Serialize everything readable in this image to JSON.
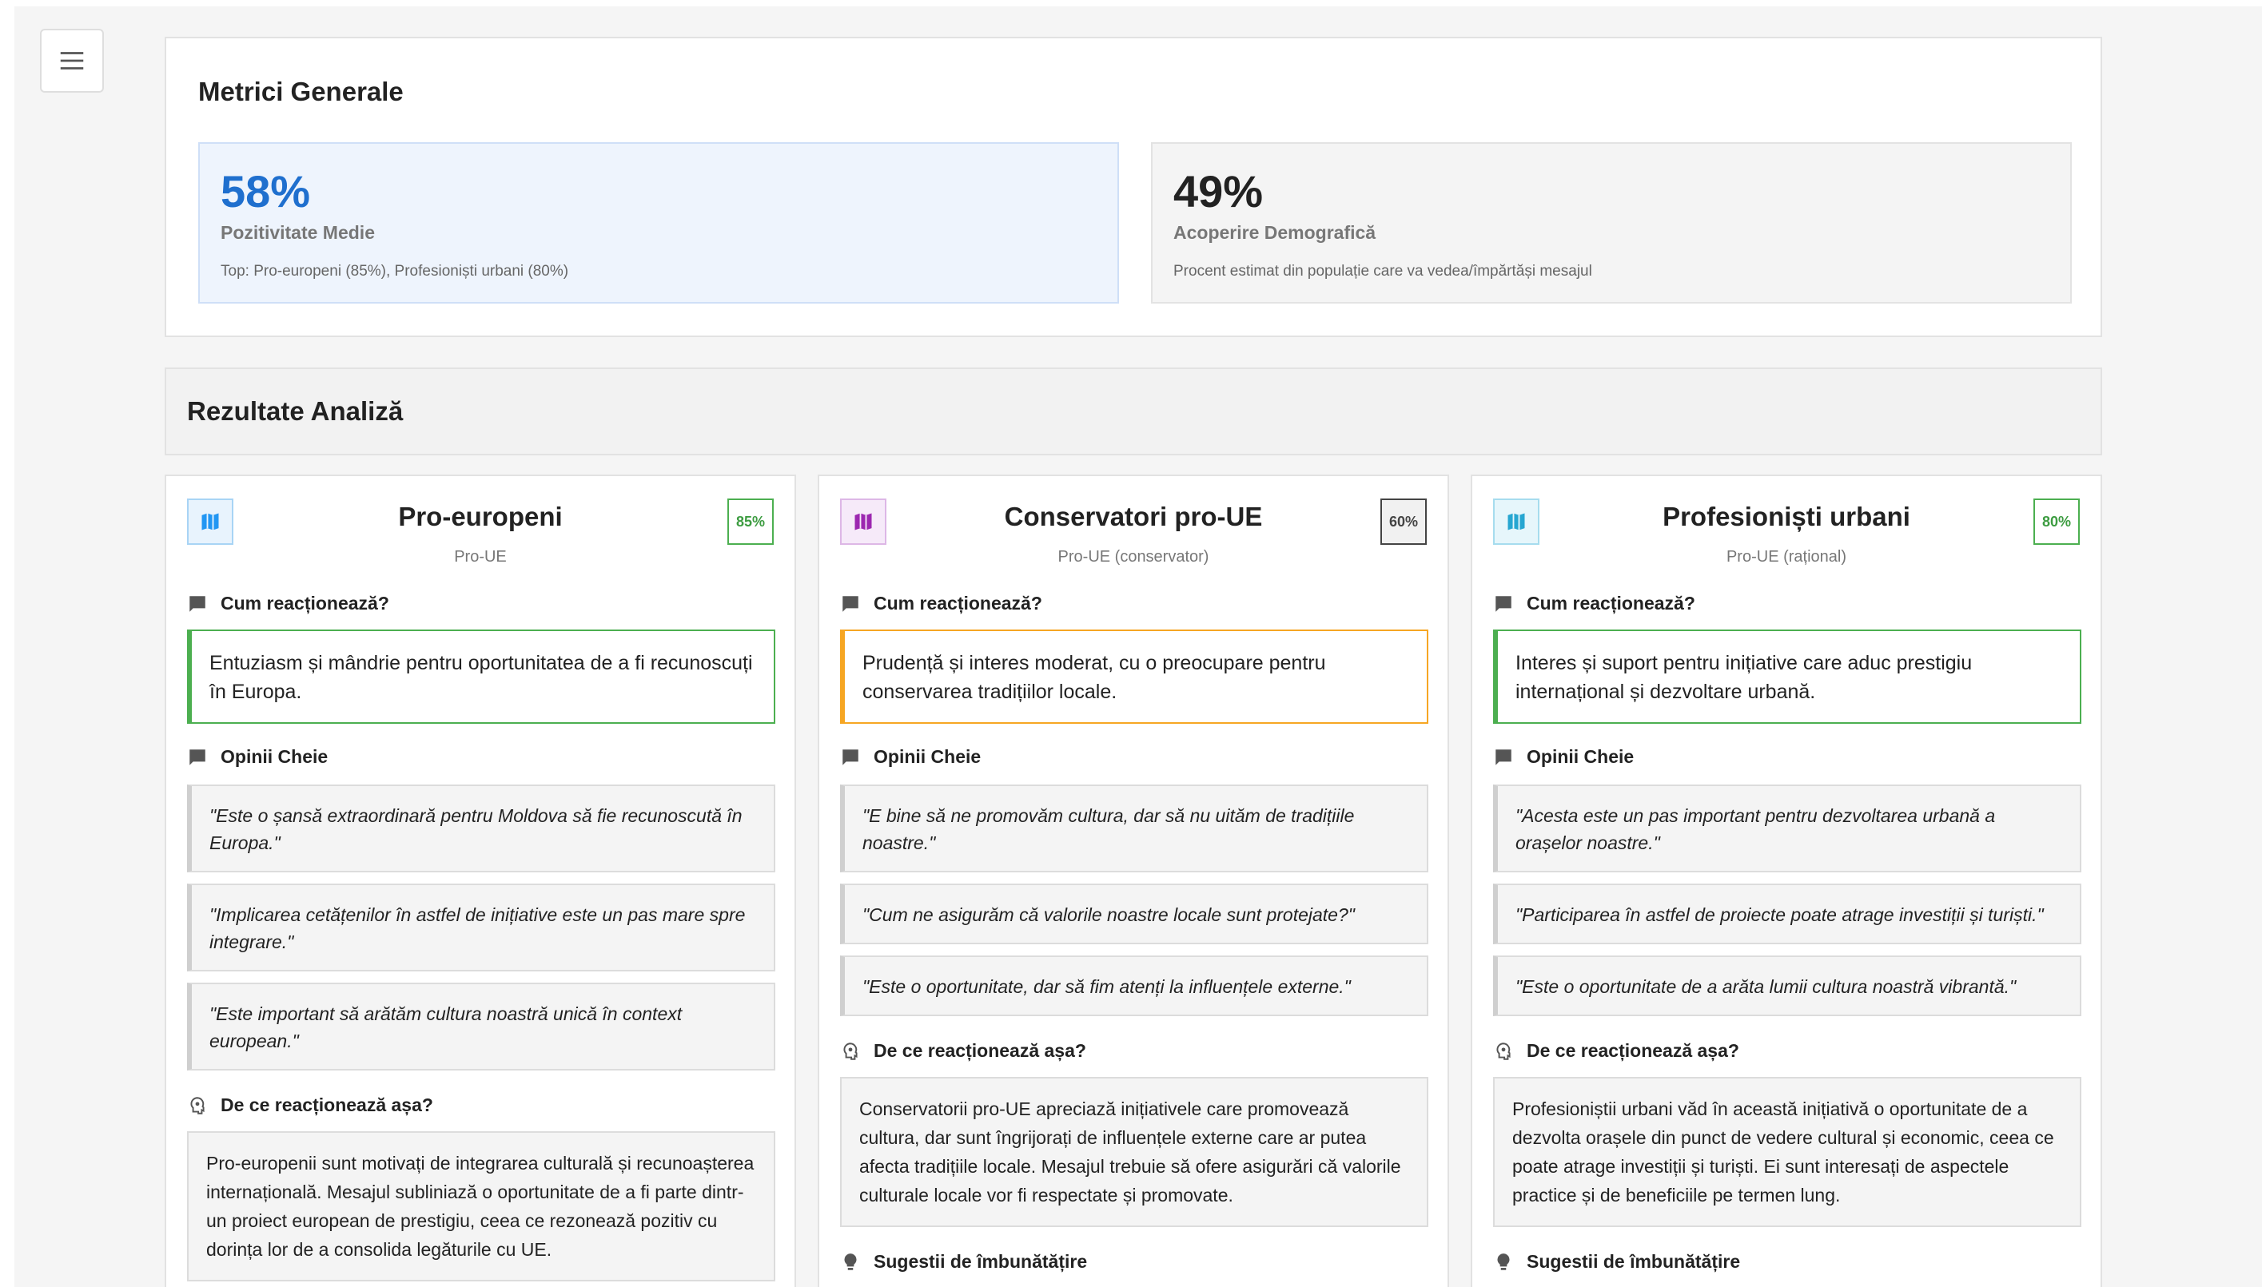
{
  "menu": {
    "icon": "menu-icon"
  },
  "metrics": {
    "title": "Metrici Generale",
    "items": [
      {
        "value": "58%",
        "label": "Pozitivitate Medie",
        "note": "Top: Pro-europeni (85%), Profesioniști urbani (80%)",
        "color": "#1f6fce"
      },
      {
        "value": "49%",
        "label": "Acoperire Demografică",
        "note": "Procent estimat din populație care va vedea/împărtăși mesajul",
        "color": "#222222"
      }
    ]
  },
  "results": {
    "title": "Rezultate Analiză",
    "cards": [
      {
        "icon": "map-icon",
        "icon_color": "#2196f3",
        "title": "Pro-europeni",
        "subtitle": "Pro-UE",
        "score": "85%",
        "react_heading": "Cum reacționează?",
        "reaction": "Entuziasm și mândrie pentru oportunitatea de a fi recunoscuți în Europa.",
        "opinions_heading": "Opinii Cheie",
        "quotes": [
          "\"Este o șansă extraordinară pentru Moldova să fie recunoscută în Europa.\"",
          "\"Implicarea cetățenilor în astfel de inițiative este un pas mare spre integrare.\"",
          "\"Este important să arătăm cultura noastră unică în context european.\""
        ],
        "why_heading": "De ce reacționează așa?",
        "reason": "Pro-europenii sunt motivați de integrarea culturală și recunoașterea internațională. Mesajul subliniază o oportunitate de a fi parte dintr-un proiect european de prestigiu, ceea ce rezonează pozitiv cu dorința lor de a consolida legăturile cu UE."
      },
      {
        "icon": "map-icon",
        "icon_color": "#9c27b0",
        "title": "Conservatori pro-UE",
        "subtitle": "Pro-UE (conservator)",
        "score": "60%",
        "react_heading": "Cum reacționează?",
        "reaction": "Prudență și interes moderat, cu o preocupare pentru conservarea tradițiilor locale.",
        "opinions_heading": "Opinii Cheie",
        "quotes": [
          "\"E bine să ne promovăm cultura, dar să nu uităm de tradițiile noastre.\"",
          "\"Cum ne asigurăm că valorile noastre locale sunt protejate?\"",
          "\"Este o oportunitate, dar să fim atenți la influențele externe.\""
        ],
        "why_heading": "De ce reacționează așa?",
        "reason": "Conservatorii pro-UE apreciază inițiativele care promovează cultura, dar sunt îngrijorați de influențele externe care ar putea afecta tradițiile locale. Mesajul trebuie să ofere asigurări că valorile culturale locale vor fi respectate și promovate.",
        "suggest_heading": "Sugestii de îmbunătățire"
      },
      {
        "icon": "map-icon",
        "icon_color": "#26a6d1",
        "title": "Profesioniști urbani",
        "subtitle": "Pro-UE (rațional)",
        "score": "80%",
        "react_heading": "Cum reacționează?",
        "reaction": "Interes și suport pentru inițiative care aduc prestigiu internațional și dezvoltare urbană.",
        "opinions_heading": "Opinii Cheie",
        "quotes": [
          "\"Acesta este un pas important pentru dezvoltarea urbană a orașelor noastre.\"",
          "\"Participarea în astfel de proiecte poate atrage investiții și turiști.\"",
          "\"Este o oportunitate de a arăta lumii cultura noastră vibrantă.\""
        ],
        "why_heading": "De ce reacționează așa?",
        "reason": "Profesioniștii urbani văd în această inițiativă o oportunitate de a dezvolta orașele din punct de vedere cultural și economic, ceea ce poate atrage investiții și turiști. Ei sunt interesați de aspectele practice și de beneficiile pe termen lung.",
        "suggest_heading": "Sugestii de îmbunătățire"
      }
    ]
  }
}
